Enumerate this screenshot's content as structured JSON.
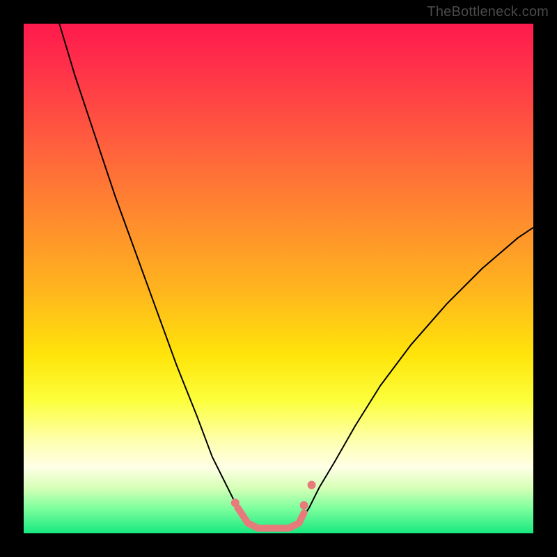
{
  "watermark": "TheBottleneck.com",
  "chart_data": {
    "type": "line",
    "title": "",
    "xlabel": "",
    "ylabel": "",
    "xlim": [
      0,
      100
    ],
    "ylim": [
      0,
      100
    ],
    "background_gradient": {
      "orientation": "vertical",
      "stops": [
        {
          "pos": 0,
          "color": "#ff1a4d"
        },
        {
          "pos": 22,
          "color": "#ff5a3f"
        },
        {
          "pos": 52,
          "color": "#ffb41e"
        },
        {
          "pos": 74,
          "color": "#fcff3c"
        },
        {
          "pos": 87,
          "color": "#ffffe6"
        },
        {
          "pos": 100,
          "color": "#18e880"
        }
      ]
    },
    "series": [
      {
        "name": "left-curve",
        "color": "#000000",
        "stroke_width": 2,
        "x": [
          7,
          10,
          14,
          18,
          22,
          26,
          30,
          34,
          37,
          40,
          42,
          44
        ],
        "y": [
          100,
          90,
          78,
          66,
          55,
          44,
          33,
          23,
          15,
          9,
          5,
          2
        ]
      },
      {
        "name": "right-curve",
        "color": "#000000",
        "stroke_width": 2,
        "x": [
          54,
          56,
          58,
          61,
          65,
          70,
          76,
          83,
          90,
          97,
          100
        ],
        "y": [
          2,
          5,
          9,
          14,
          21,
          29,
          37,
          45,
          52,
          58,
          60
        ]
      },
      {
        "name": "trough-highlight",
        "color": "#e77b7b",
        "stroke_width": 10,
        "linecap": "round",
        "x": [
          42,
          44,
          46,
          48,
          50,
          52,
          54,
          55
        ],
        "y": [
          5,
          2,
          1,
          1,
          1,
          1,
          2,
          4
        ]
      }
    ],
    "markers": [
      {
        "x": 41.5,
        "y": 6,
        "r": 6,
        "color": "#e77b7b"
      },
      {
        "x": 55.0,
        "y": 5.5,
        "r": 6,
        "color": "#e77b7b"
      },
      {
        "x": 56.5,
        "y": 9.5,
        "r": 6,
        "color": "#e77b7b"
      }
    ]
  }
}
